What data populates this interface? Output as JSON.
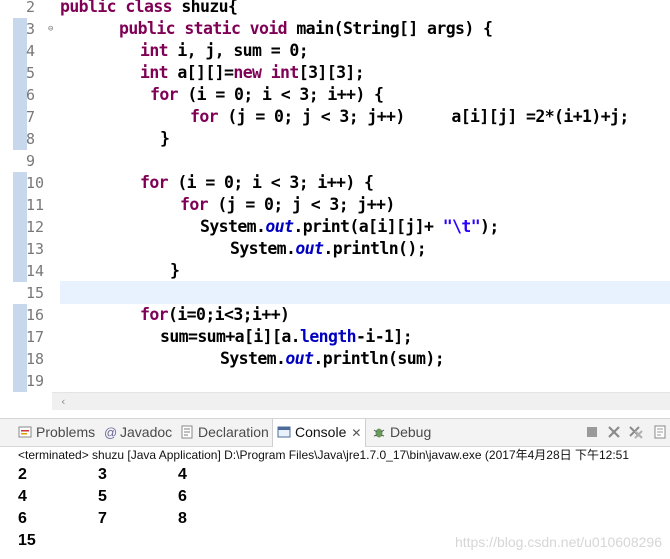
{
  "editor": {
    "line_numbers": [
      "2",
      "3",
      "4",
      "5",
      "6",
      "7",
      "8",
      "9",
      "10",
      "11",
      "12",
      "13",
      "14",
      "15",
      "16",
      "17",
      "18",
      "19"
    ],
    "marked_lines": [
      "3",
      "4",
      "5",
      "6",
      "7",
      "8",
      "10",
      "11",
      "12",
      "13",
      "14",
      "16",
      "17",
      "18",
      "19"
    ],
    "current_line": "15",
    "code": {
      "l2": {
        "kw": "public class",
        "rest": " shuzu{"
      },
      "l3": {
        "kw1": "public static void",
        "rest": " main(String[] args) {"
      },
      "l4": {
        "kw": "int",
        "rest": " i, j, sum = 0;"
      },
      "l5": {
        "kw": "int",
        "mid": " a[][]=",
        "kw2": "new",
        "sp": " ",
        "kw3": "int",
        "rest": "[3][3];"
      },
      "l6": {
        "kw": "for",
        "rest": " (i = 0; i < 3; i++) {"
      },
      "l7": {
        "kw": "for",
        "rest": " (j = 0; j < 3; j++)     a[i][j] =2*(i+1)+j;"
      },
      "l8": {
        "text": "}"
      },
      "l10": {
        "kw": "for",
        "rest": " (i = 0; i < 3; i++) {"
      },
      "l11": {
        "kw": "for",
        "rest": " (j = 0; j < 3; j++)"
      },
      "l12": {
        "a": "System.",
        "fld": "out",
        "b": ".print(a[i][j]+ ",
        "str": "\"\\t\"",
        "c": ");"
      },
      "l13": {
        "a": "System.",
        "fld": "out",
        "b": ".println();"
      },
      "l14": {
        "text": "}"
      },
      "l16": {
        "kw": "for",
        "rest": "(i=0;i<3;i++)"
      },
      "l17": {
        "a": "sum=sum+a[i][a.",
        "fld": "length",
        "b": "-i-1];"
      },
      "l18": {
        "a": "System.",
        "fld": "out",
        "b": ".println(sum);"
      }
    }
  },
  "console": {
    "tabs": [
      {
        "label": "Problems",
        "icon": "problems-icon"
      },
      {
        "label": "Javadoc",
        "icon": "at-icon"
      },
      {
        "label": "Declaration",
        "icon": "declaration-icon"
      },
      {
        "label": "Console",
        "icon": "console-icon",
        "active": true
      },
      {
        "label": "Debug",
        "icon": "bug-icon"
      }
    ],
    "close_glyph": "✕",
    "terminated": "<terminated> shuzu [Java Application] D:\\Program Files\\Java\\jre1.7.0_17\\bin\\javaw.exe (2017年4月28日 下午12:51",
    "output_rows": [
      [
        "2",
        "3",
        "4"
      ],
      [
        "4",
        "5",
        "6"
      ],
      [
        "6",
        "7",
        "8"
      ],
      [
        "15"
      ]
    ],
    "watermark": "https://blog.csdn.net/u010608296"
  }
}
